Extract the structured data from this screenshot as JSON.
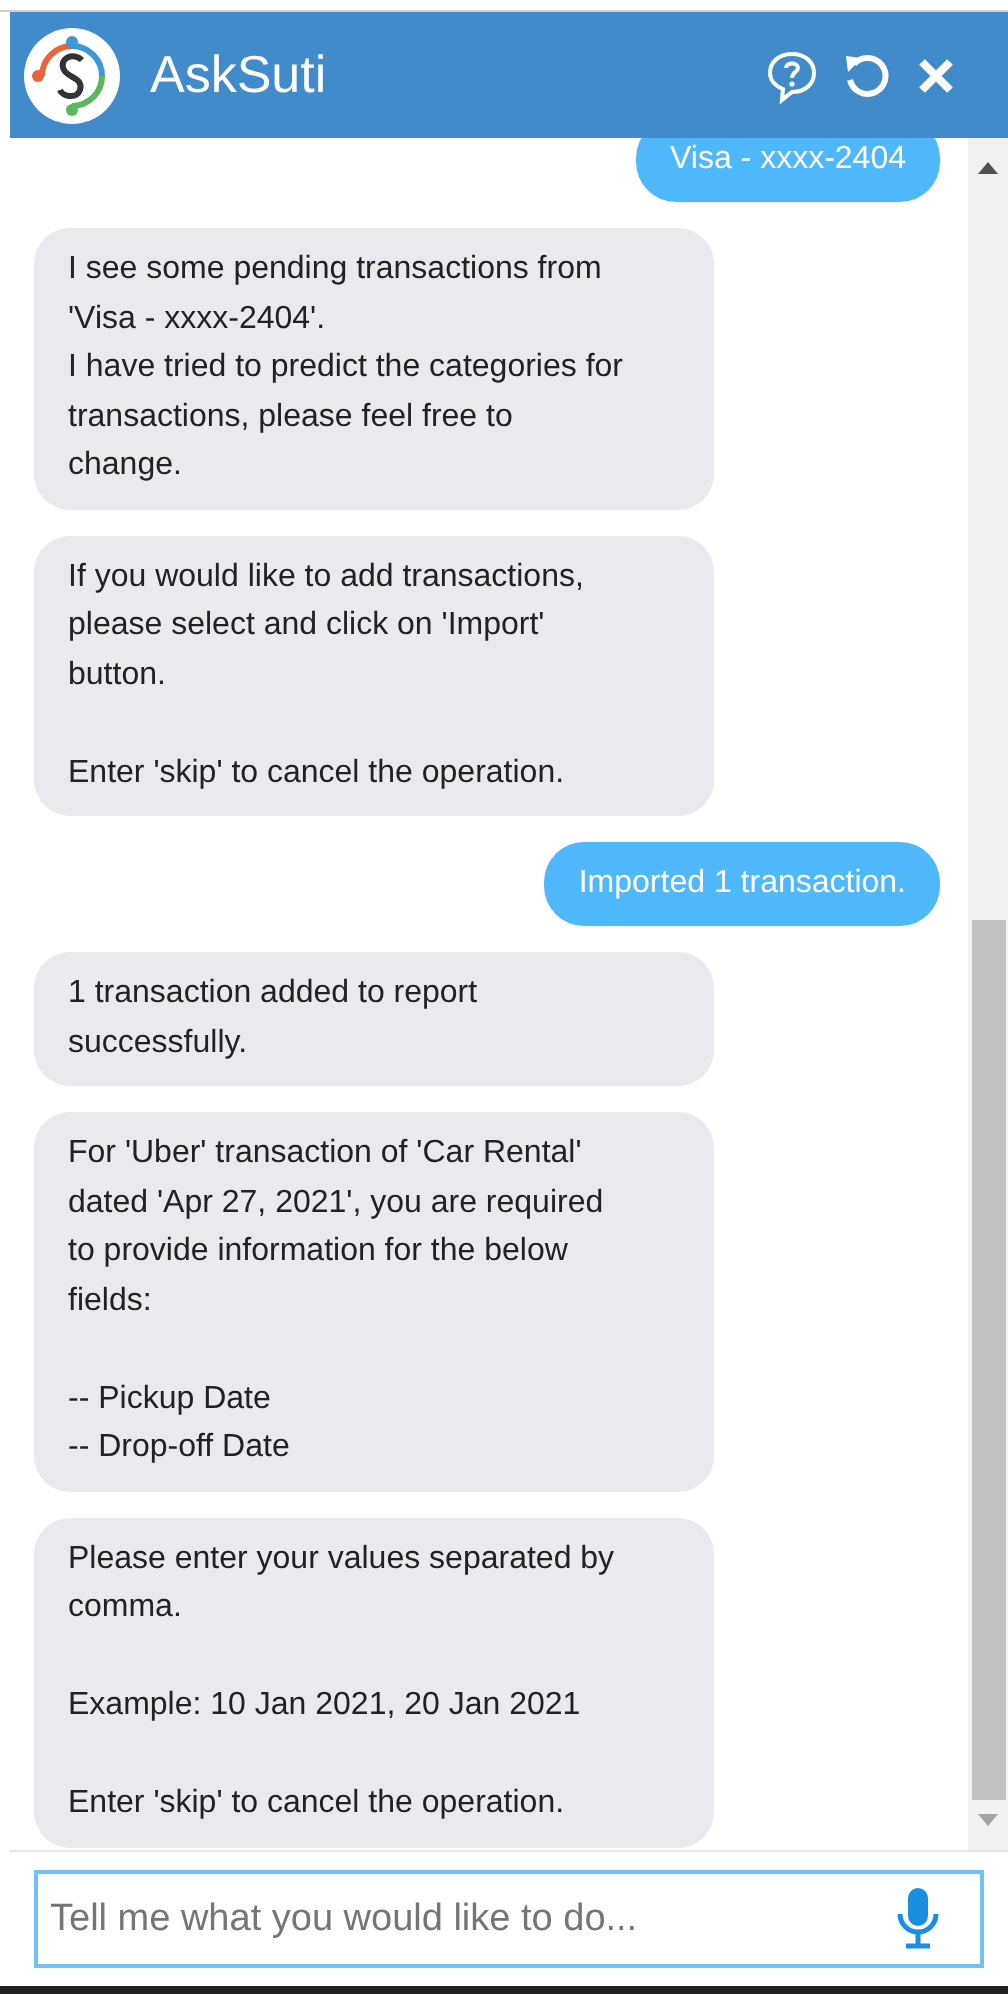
{
  "header": {
    "title": "AskSuti"
  },
  "messages": [
    {
      "kind": "user",
      "text": "Visa - xxxx-2404"
    },
    {
      "kind": "bot",
      "text": "I see some pending transactions from\n'Visa - xxxx-2404'.\nI have tried to predict the categories for\ntransactions, please feel free to\nchange."
    },
    {
      "kind": "bot",
      "text": "If you would like to add transactions,\nplease select and click on 'Import'\nbutton.\n\nEnter 'skip' to cancel the operation."
    },
    {
      "kind": "user",
      "text": "Imported 1 transaction."
    },
    {
      "kind": "bot",
      "text": "1 transaction added to report\nsuccessfully."
    },
    {
      "kind": "bot",
      "text": "For 'Uber' transaction of 'Car Rental'\ndated 'Apr 27, 2021', you are required\nto provide information for the below\nfields:\n\n-- Pickup Date\n-- Drop-off Date"
    },
    {
      "kind": "bot",
      "text": "Please enter your values separated by\ncomma.\n\nExample: 10 Jan 2021, 20 Jan 2021\n\nEnter 'skip' to cancel the operation."
    }
  ],
  "input": {
    "placeholder": "Tell me what you would like to do..."
  }
}
